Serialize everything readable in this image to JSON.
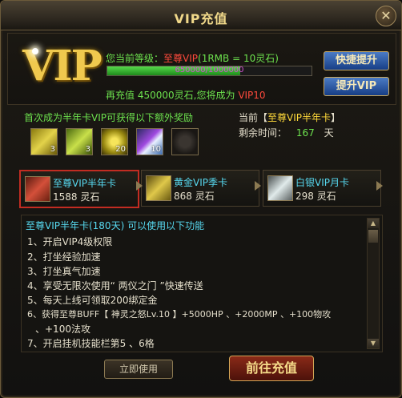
{
  "window": {
    "title": "VIP充值"
  },
  "vip": {
    "logo": "VIP",
    "level_label": "您当前等级：",
    "level_value": "至尊VIP",
    "rate": "(1RMB = 10灵石)",
    "progress_text": "650000/1000000",
    "progress_fraction": 0.65,
    "next_pre": "再充值",
    "next_amount": "450000灵石",
    "next_mid": ",您将成为",
    "next_level": "VIP10"
  },
  "buttons": {
    "quick_upgrade": "快捷提升",
    "upgrade_vip": "提升VIP",
    "use_now": "立即使用",
    "go_recharge": "前往充值"
  },
  "reward": {
    "title": "首次成为半年卡VIP可获得以下额外奖励",
    "items": [
      {
        "icon": "gold-wings-icon",
        "count": "3"
      },
      {
        "icon": "green-wings-icon",
        "count": "3"
      },
      {
        "icon": "gold-orb-icon",
        "count": "20"
      },
      {
        "icon": "purple-crystal-icon",
        "count": "10"
      },
      {
        "icon": "empty-orb-icon",
        "count": ""
      }
    ]
  },
  "current": {
    "label_pre": "当前【",
    "card": "至尊VIP半年卡",
    "label_post": "】",
    "remain_label": "剩余时间：",
    "remain_days": "167",
    "unit": "天"
  },
  "cards": [
    {
      "name": "至尊VIP半年卡",
      "price": "1588 灵石",
      "icon": "red-jade-icon"
    },
    {
      "name": "黄金VIP季卡",
      "price": "868 灵石",
      "icon": "gold-jade-icon"
    },
    {
      "name": "白银VIP月卡",
      "price": "298 灵石",
      "icon": "silver-jade-icon"
    }
  ],
  "features": {
    "title": "至尊VIP半年卡(180天) 可以使用以下功能",
    "lines": [
      "1、开启VIP4级权限",
      "2、打坐经验加速",
      "3、打坐真气加速",
      "4、享受无限次使用“ 两仪之门 ”快速传送",
      "5、每天上线可领取200绑定金",
      "6、获得至尊BUFF【 神灵之怒Lv.10 】+5000HP 、+2000MP 、+100物攻",
      "、+100法攻",
      "7、开启挂机技能栏第5 、6格"
    ]
  },
  "colors": {
    "accent_gold": "#f1d98a",
    "green": "#6de24e",
    "red": "#ff4a3c",
    "cyan": "#57d9f0"
  }
}
